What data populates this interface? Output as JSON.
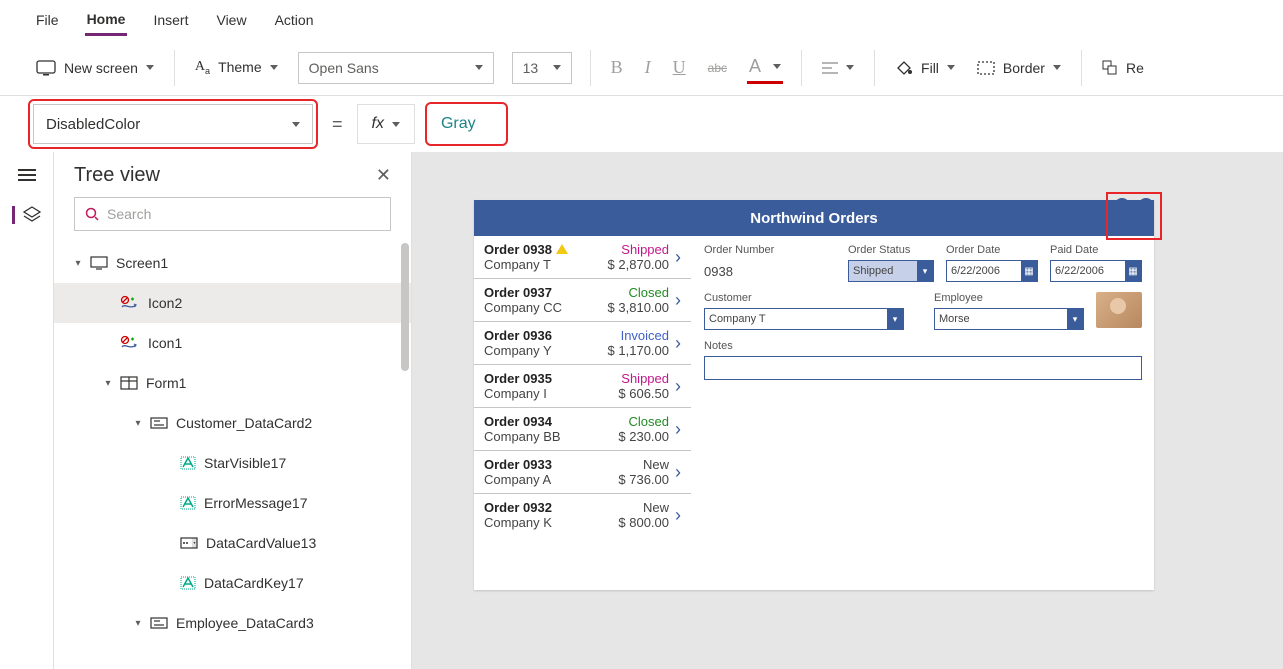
{
  "menu": {
    "file": "File",
    "home": "Home",
    "insert": "Insert",
    "view": "View",
    "action": "Action"
  },
  "ribbon": {
    "new_screen": "New screen",
    "theme": "Theme",
    "font": "Open Sans",
    "size": "13",
    "bold": "B",
    "italic": "I",
    "underline": "U",
    "strike": "abc",
    "textcolor": "A",
    "fill": "Fill",
    "border": "Border",
    "re": "Re"
  },
  "formula": {
    "property": "DisabledColor",
    "value": "Gray",
    "equals": "=",
    "fx": "fx"
  },
  "tree": {
    "title": "Tree view",
    "search_placeholder": "Search",
    "items": [
      {
        "label": "Screen1",
        "indent": 18,
        "exp": "▾",
        "icon": "screen"
      },
      {
        "label": "Icon2",
        "indent": 48,
        "icon": "iconctrl",
        "selected": true
      },
      {
        "label": "Icon1",
        "indent": 48,
        "icon": "iconctrl"
      },
      {
        "label": "Form1",
        "indent": 48,
        "exp": "▾",
        "icon": "form"
      },
      {
        "label": "Customer_DataCard2",
        "indent": 78,
        "exp": "▾",
        "icon": "datacard"
      },
      {
        "label": "StarVisible17",
        "indent": 108,
        "icon": "label"
      },
      {
        "label": "ErrorMessage17",
        "indent": 108,
        "icon": "label"
      },
      {
        "label": "DataCardValue13",
        "indent": 108,
        "icon": "dropdown"
      },
      {
        "label": "DataCardKey17",
        "indent": 108,
        "icon": "label"
      },
      {
        "label": "Employee_DataCard3",
        "indent": 78,
        "exp": "▾",
        "icon": "datacard"
      }
    ]
  },
  "app": {
    "title": "Northwind Orders",
    "orders": [
      {
        "id": "Order 0938",
        "company": "Company T",
        "status": "Shipped",
        "amount": "$ 2,870.00",
        "warn": true
      },
      {
        "id": "Order 0937",
        "company": "Company CC",
        "status": "Closed",
        "amount": "$ 3,810.00"
      },
      {
        "id": "Order 0936",
        "company": "Company Y",
        "status": "Invoiced",
        "amount": "$ 1,170.00"
      },
      {
        "id": "Order 0935",
        "company": "Company I",
        "status": "Shipped",
        "amount": "$ 606.50"
      },
      {
        "id": "Order 0934",
        "company": "Company BB",
        "status": "Closed",
        "amount": "$ 230.00"
      },
      {
        "id": "Order 0933",
        "company": "Company A",
        "status": "New",
        "amount": "$ 736.00"
      },
      {
        "id": "Order 0932",
        "company": "Company K",
        "status": "New",
        "amount": "$ 800.00"
      }
    ],
    "detail": {
      "order_number_lbl": "Order Number",
      "order_number": "0938",
      "order_status_lbl": "Order Status",
      "order_status": "Shipped",
      "order_date_lbl": "Order Date",
      "order_date": "6/22/2006",
      "paid_date_lbl": "Paid Date",
      "paid_date": "6/22/2006",
      "customer_lbl": "Customer",
      "customer": "Company T",
      "employee_lbl": "Employee",
      "employee": "Morse",
      "notes_lbl": "Notes"
    }
  }
}
